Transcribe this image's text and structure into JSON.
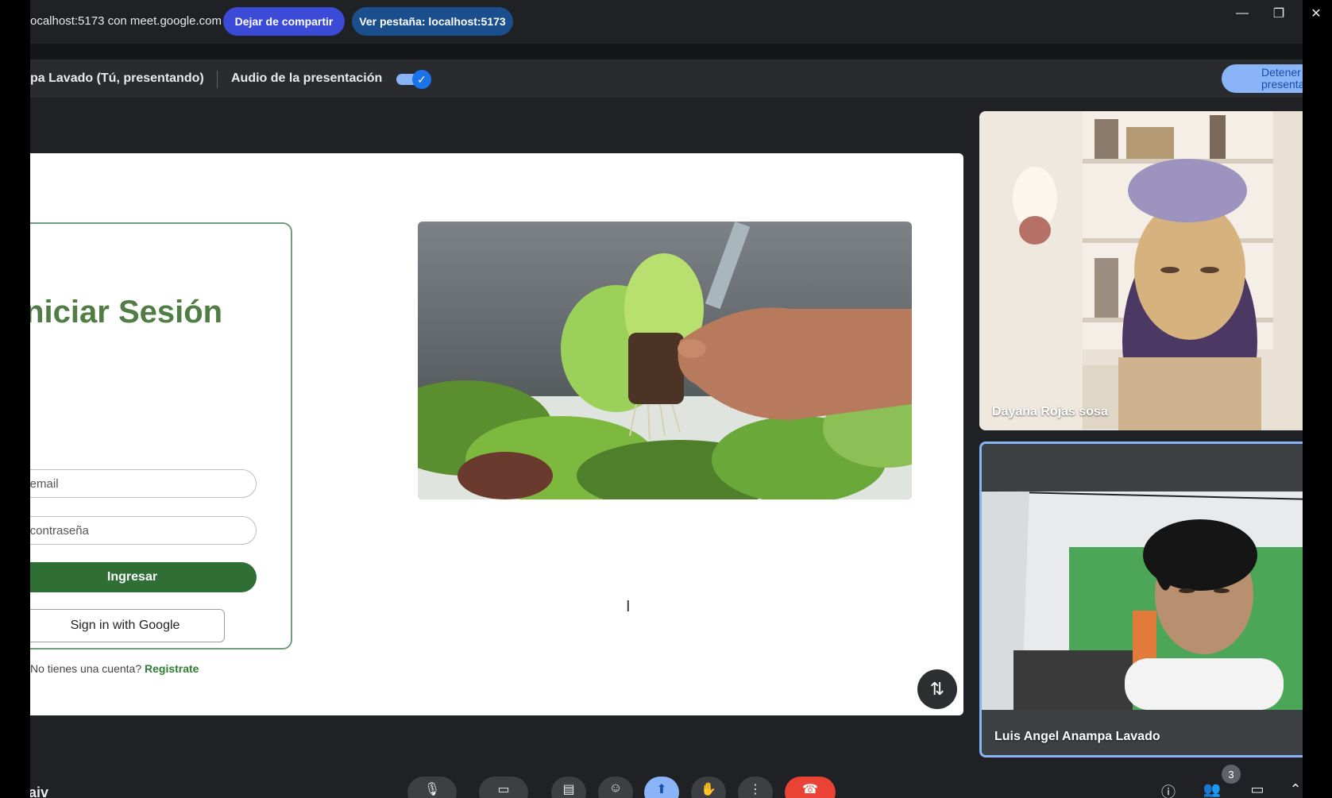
{
  "share_bar": {
    "sharing_text": "ocalhost:5173 con meet.google.com",
    "stop_sharing_label": "Dejar de compartir",
    "view_tab_label": "Ver pestaña: localhost:5173"
  },
  "window": {
    "minimize_icon": "—",
    "restore_icon": "❐",
    "close_icon": "✕"
  },
  "presenting_bar": {
    "presenter_text": "pa Lavado (Tú, presentando)",
    "audio_label": "Audio de la presentación",
    "audio_enabled": true,
    "toggle_check": "✓",
    "stop_presenting_label": "Detener presentar"
  },
  "shared_page": {
    "title": "Iniciar Sesión",
    "email_placeholder": "tu email",
    "password_placeholder": "tu contraseña",
    "login_button": "Ingresar",
    "google_button": "Sign in with Google",
    "no_account_text": "No tienes una cuenta?",
    "register_link": "Registrate",
    "text_cursor": "I",
    "fab_icon": "⇅"
  },
  "participants": [
    {
      "name": "Dayana Rojas sosa"
    },
    {
      "name": "Luis Angel Anampa Lavado"
    }
  ],
  "bottom_bar": {
    "meeting_code": "-aiv",
    "participant_count": "3",
    "controls": {
      "mic_icon": "🎙",
      "camera_icon": "▭",
      "captions_icon": "▤",
      "emoji_icon": "☺",
      "present_icon": "⬆",
      "hand_icon": "✋",
      "more_icon": "⋮",
      "end_icon": "☎",
      "info_icon": "ⓘ",
      "people_icon": "👥",
      "chat_icon": "▭",
      "activities_icon": "⌃",
      "chevron_up": "⌃"
    }
  },
  "colors": {
    "meet_dark": "#202124",
    "share_blue": "#3b4bd8",
    "view_tab_blue": "#1a4e8c",
    "brand_green": "#4f7d43",
    "button_green": "#2f6f35",
    "link_green": "#2e7d32",
    "accent_blue": "#8ab4f8",
    "end_red": "#ea4335"
  }
}
